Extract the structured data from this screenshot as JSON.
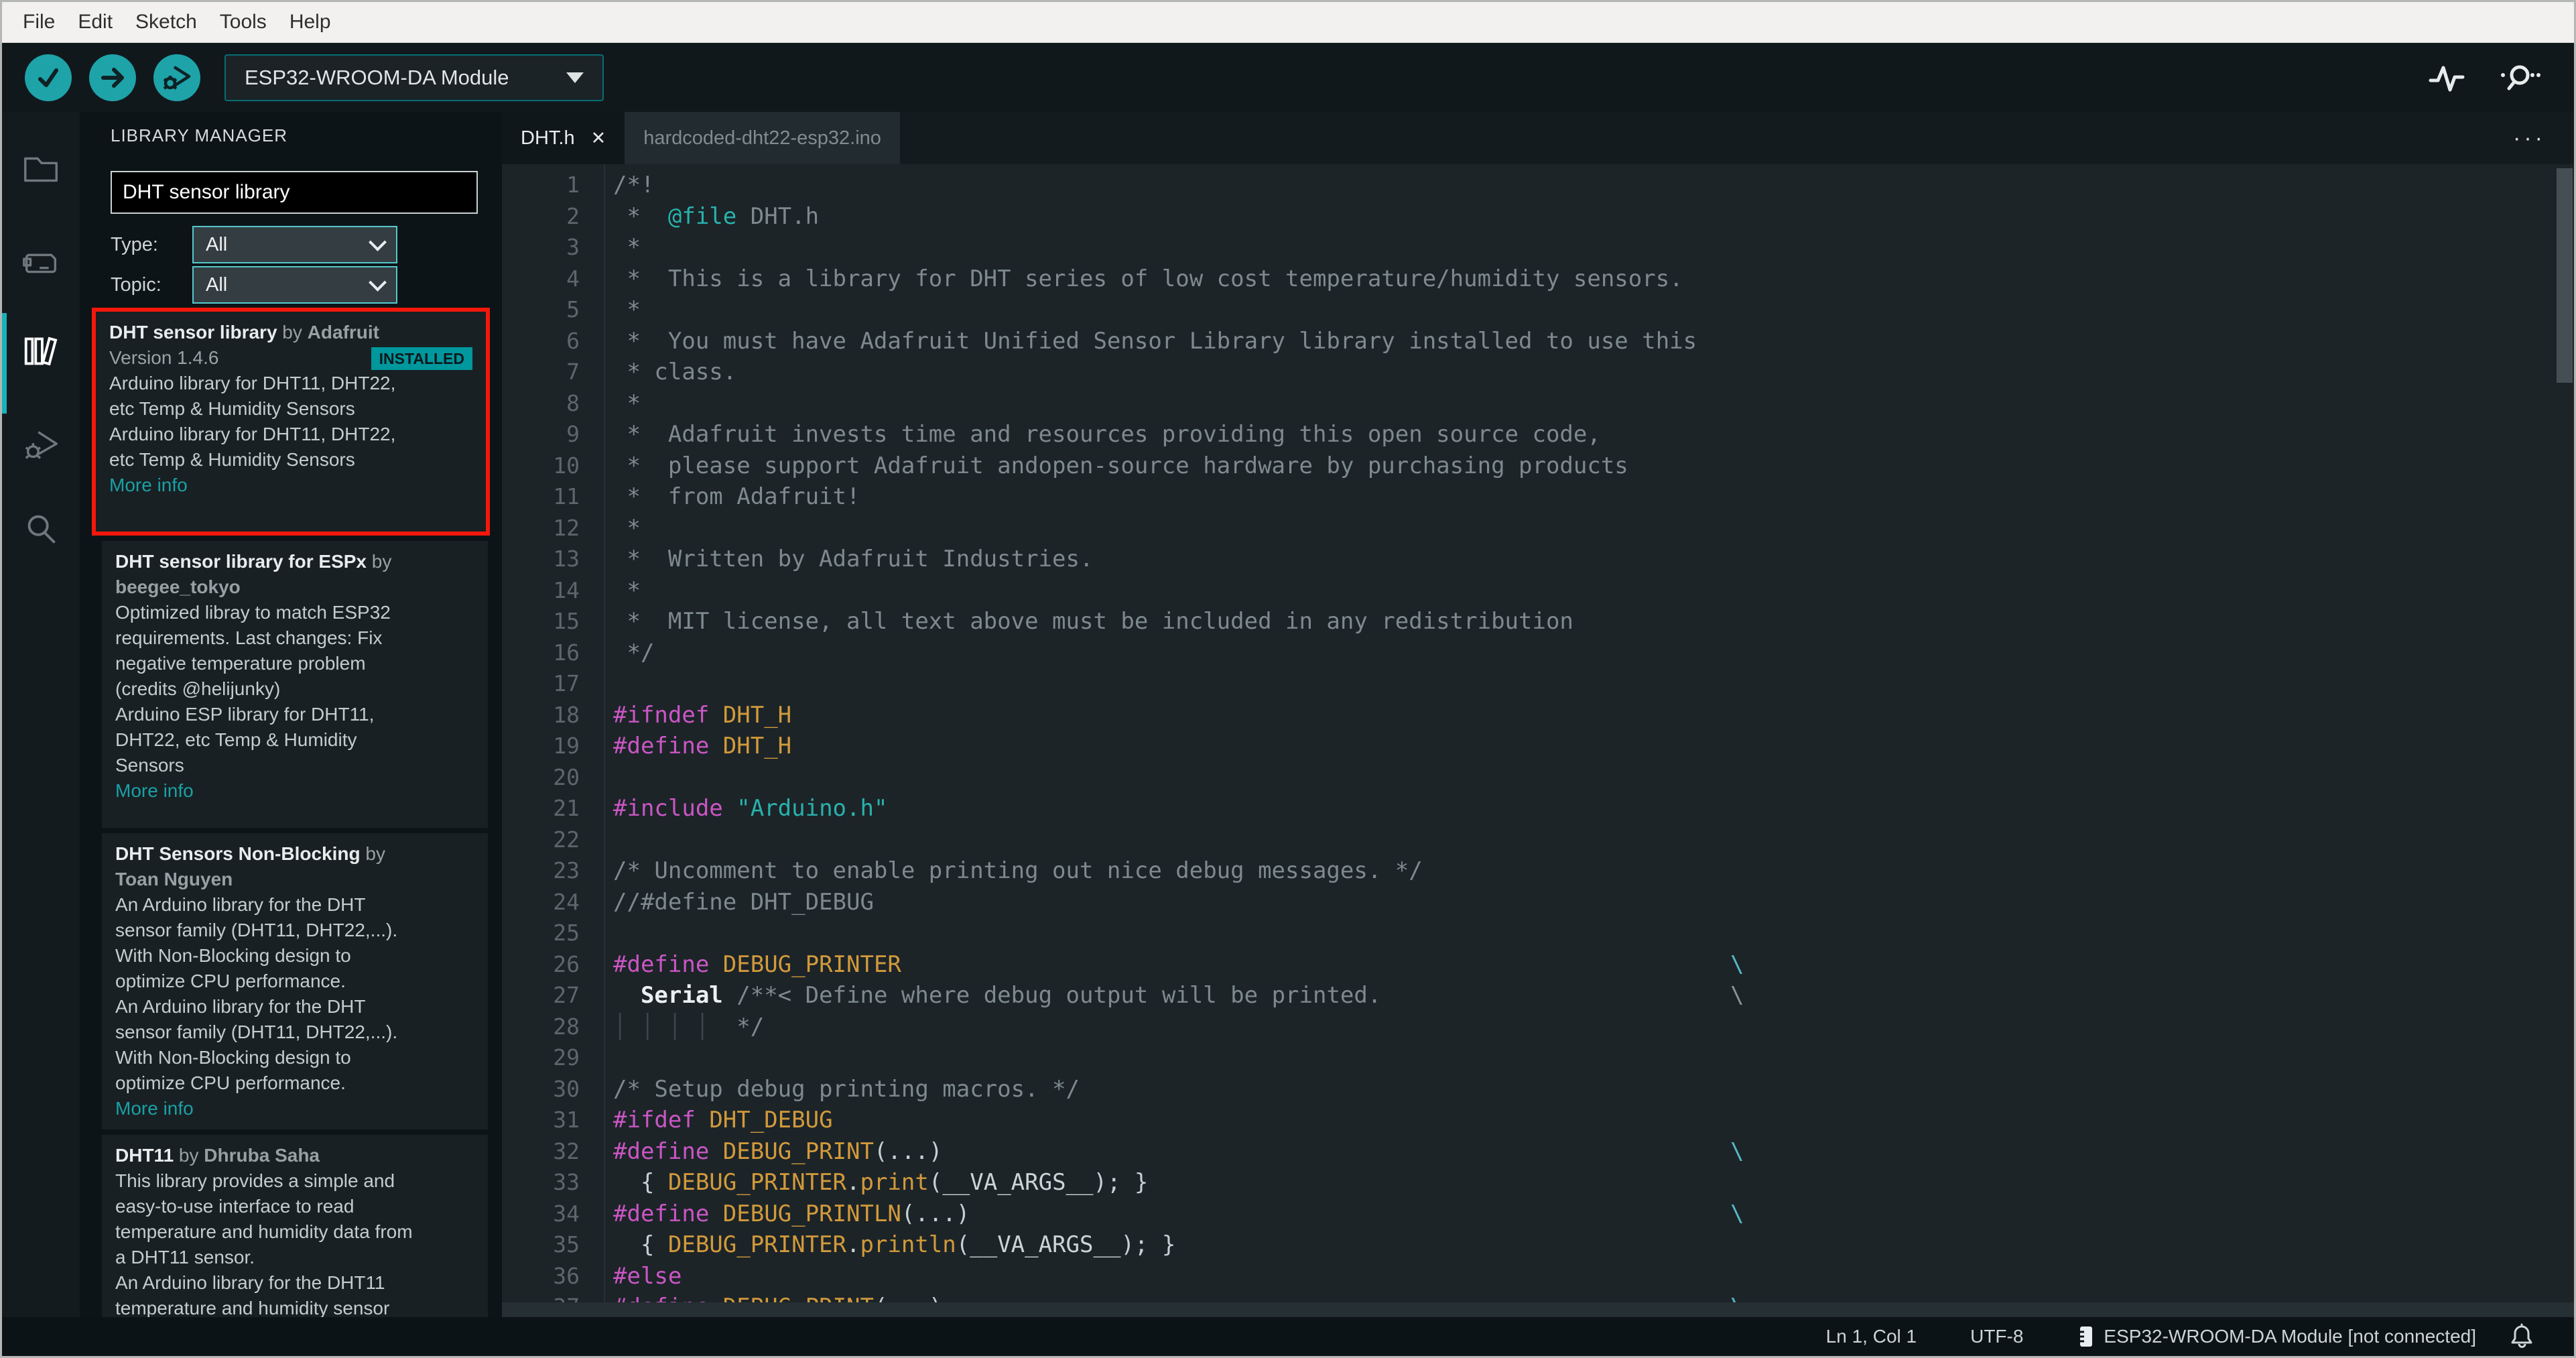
{
  "menu": {
    "items": [
      "File",
      "Edit",
      "Sketch",
      "Tools",
      "Help"
    ]
  },
  "toolbar": {
    "verify_button": "verify",
    "upload_button": "upload",
    "debug_button": "start-debugging",
    "board_selector_value": "ESP32-WROOM-DA Module"
  },
  "activity_bar": {
    "items": [
      "sketchbook",
      "boards-manager",
      "library-manager",
      "debug",
      "search"
    ],
    "active_item": "library-manager"
  },
  "library_manager": {
    "title": "LIBRARY MANAGER",
    "search_value": "DHT sensor library",
    "filters": [
      {
        "label": "Type:",
        "value": "All"
      },
      {
        "label": "Topic:",
        "value": "All"
      }
    ],
    "more_info_label": "More info",
    "installed_label": "INSTALLED",
    "entries": [
      {
        "name": "DHT sensor library",
        "by": "by",
        "author": "Adafruit",
        "wrap_author": false,
        "version": "Version 1.4.6",
        "installed": true,
        "highlighted": true,
        "desc": [
          "Arduino library for DHT11, DHT22,",
          "etc Temp & Humidity Sensors",
          "Arduino library for DHT11, DHT22,",
          "etc Temp & Humidity Sensors"
        ]
      },
      {
        "name": "DHT sensor library for ESPx",
        "by": "by",
        "author": "beegee_tokyo",
        "wrap_author": true,
        "desc": [
          "Optimized libray to match ESP32",
          "requirements. Last changes: Fix",
          "negative temperature problem",
          "(credits @helijunky)",
          "Arduino ESP library for DHT11,",
          "DHT22, etc Temp & Humidity",
          "Sensors"
        ]
      },
      {
        "name": "DHT Sensors Non-Blocking",
        "by": "by",
        "author": "Toan Nguyen",
        "wrap_author": true,
        "desc": [
          "An Arduino library for the DHT",
          "sensor family (DHT11, DHT22,...).",
          "With Non-Blocking design to",
          "optimize CPU performance.",
          "An Arduino library for the DHT",
          "sensor family (DHT11, DHT22,...).",
          "With Non-Blocking design to",
          "optimize CPU performance."
        ]
      },
      {
        "name": "DHT11",
        "by": "by",
        "author": "Dhruba Saha",
        "wrap_author": false,
        "desc": [
          "This library provides a simple and",
          "easy-to-use interface to read",
          "temperature and humidity data from",
          "a DHT11 sensor.",
          "An Arduino library for the DHT11",
          "temperature and humidity sensor"
        ]
      }
    ]
  },
  "editor": {
    "tabs": [
      {
        "label": "DHT.h",
        "active": true,
        "closable": true
      },
      {
        "label": "hardcoded-dht22-esp32.ino",
        "active": false,
        "closable": false
      }
    ],
    "close_glyph": "✕",
    "overflow_menu": "···",
    "code": {
      "lines": [
        {
          "t": [
            [
              "c",
              "/*!"
            ]
          ]
        },
        {
          "t": [
            [
              "c",
              " *  "
            ],
            [
              "t",
              "@file"
            ],
            [
              "c",
              " DHT.h"
            ]
          ]
        },
        {
          "t": [
            [
              "c",
              " *"
            ]
          ]
        },
        {
          "t": [
            [
              "c",
              " *  This is a library for DHT series of low cost temperature/humidity sensors."
            ]
          ]
        },
        {
          "t": [
            [
              "c",
              " *"
            ]
          ]
        },
        {
          "t": [
            [
              "c",
              " *  You must have Adafruit Unified Sensor Library library installed to use this"
            ]
          ]
        },
        {
          "t": [
            [
              "c",
              " * class."
            ]
          ]
        },
        {
          "t": [
            [
              "c",
              " *"
            ]
          ]
        },
        {
          "t": [
            [
              "c",
              " *  Adafruit invests time and resources providing this open source code,"
            ]
          ]
        },
        {
          "t": [
            [
              "c",
              " *  please support Adafruit andopen-source hardware by purchasing products"
            ]
          ]
        },
        {
          "t": [
            [
              "c",
              " *  from Adafruit!"
            ]
          ]
        },
        {
          "t": [
            [
              "c",
              " *"
            ]
          ]
        },
        {
          "t": [
            [
              "c",
              " *  Written by Adafruit Industries."
            ]
          ]
        },
        {
          "t": [
            [
              "c",
              " *"
            ]
          ]
        },
        {
          "t": [
            [
              "c",
              " *  MIT license, all text above must be included in any redistribution"
            ]
          ]
        },
        {
          "t": [
            [
              "c",
              " */"
            ]
          ]
        },
        {
          "t": []
        },
        {
          "t": [
            [
              "p",
              "#ifndef"
            ],
            [
              "w",
              " "
            ],
            [
              "m",
              "DHT_H"
            ]
          ]
        },
        {
          "t": [
            [
              "p",
              "#define"
            ],
            [
              "w",
              " "
            ],
            [
              "m",
              "DHT_H"
            ]
          ]
        },
        {
          "t": []
        },
        {
          "t": [
            [
              "p",
              "#include"
            ],
            [
              "w",
              " "
            ],
            [
              "s",
              "\"Arduino.h\""
            ]
          ]
        },
        {
          "t": []
        },
        {
          "t": [
            [
              "c",
              "/* Uncomment to enable printing out nice debug messages. */"
            ]
          ]
        },
        {
          "t": [
            [
              "c",
              "//#define DHT_DEBUG"
            ]
          ]
        },
        {
          "t": []
        },
        {
          "t": [
            [
              "p",
              "#define"
            ],
            [
              "w",
              " "
            ],
            [
              "m",
              "DEBUG_PRINTER"
            ]
          ],
          "cont": "cyan"
        },
        {
          "t": [
            [
              "w",
              "  "
            ],
            [
              "b",
              "Serial"
            ],
            [
              "c",
              " /**< Define where debug output will be printed."
            ]
          ],
          "cont": "gray"
        },
        {
          "t": [
            [
              "g",
              "│ │ │ │"
            ],
            [
              "c",
              "  */"
            ]
          ]
        },
        {
          "t": []
        },
        {
          "t": [
            [
              "c",
              "/* Setup debug printing macros. */"
            ]
          ]
        },
        {
          "t": [
            [
              "p",
              "#ifdef"
            ],
            [
              "w",
              " "
            ],
            [
              "m",
              "DHT_DEBUG"
            ]
          ]
        },
        {
          "t": [
            [
              "p",
              "#define"
            ],
            [
              "w",
              " "
            ],
            [
              "m",
              "DEBUG_PRINT"
            ],
            [
              "n",
              "(...)"
            ]
          ],
          "cont": "cyan"
        },
        {
          "t": [
            [
              "n",
              "  { "
            ],
            [
              "m",
              "DEBUG_PRINTER"
            ],
            [
              "n",
              "."
            ],
            [
              "m",
              "print"
            ],
            [
              "n",
              "("
            ],
            [
              "a",
              "__VA_ARGS__"
            ],
            [
              "n",
              "); }"
            ]
          ]
        },
        {
          "t": [
            [
              "p",
              "#define"
            ],
            [
              "w",
              " "
            ],
            [
              "m",
              "DEBUG_PRINTLN"
            ],
            [
              "n",
              "(...)"
            ]
          ],
          "cont": "cyan"
        },
        {
          "t": [
            [
              "n",
              "  { "
            ],
            [
              "m",
              "DEBUG_PRINTER"
            ],
            [
              "n",
              "."
            ],
            [
              "m",
              "println"
            ],
            [
              "n",
              "("
            ],
            [
              "a",
              "__VA_ARGS__"
            ],
            [
              "n",
              "); }"
            ]
          ]
        },
        {
          "t": [
            [
              "p",
              "#else"
            ]
          ]
        },
        {
          "t": [
            [
              "p",
              "#define"
            ],
            [
              "w",
              " "
            ],
            [
              "m",
              "DEBUG_PRINT"
            ],
            [
              "n",
              "(...)"
            ]
          ],
          "cont": "cyan"
        }
      ]
    }
  },
  "status_bar": {
    "position": "Ln 1, Col 1",
    "encoding": "UTF-8",
    "board_status": "ESP32-WROOM-DA Module [not connected]"
  },
  "colors": {
    "accent_teal": "#00979d",
    "button_teal": "#1ea3a9",
    "highlight_red": "#f3170c",
    "installed_badge": "#00979d",
    "link_teal": "#1aa0a6"
  }
}
